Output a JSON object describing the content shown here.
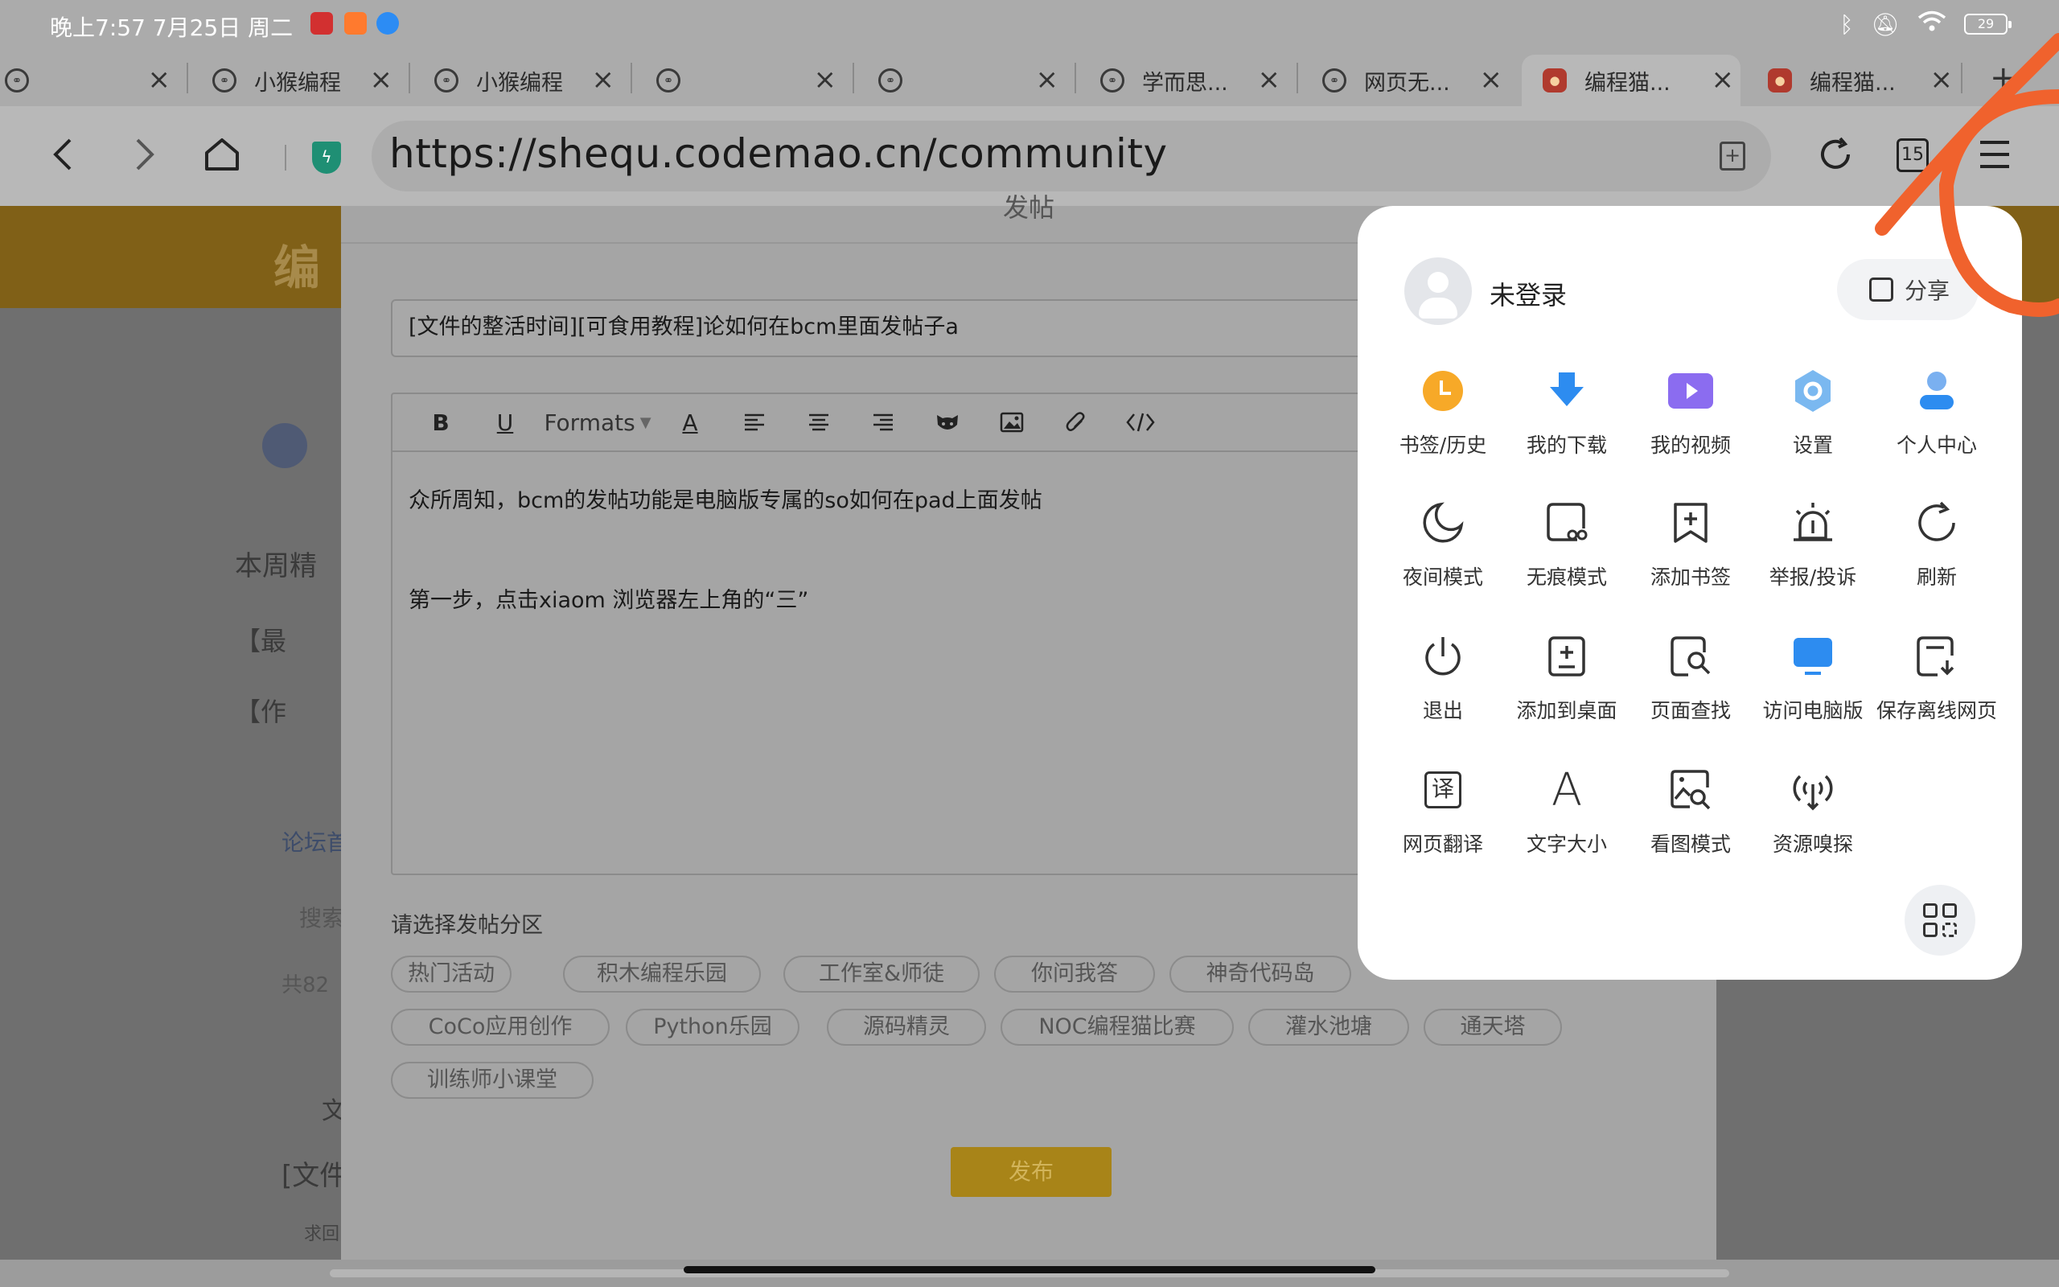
{
  "status_bar": {
    "time": "晚上7:57 7月25日 周二",
    "battery": "29"
  },
  "tabs": [
    {
      "title": ""
    },
    {
      "title": "小猴编程"
    },
    {
      "title": "小猴编程"
    },
    {
      "title": ""
    },
    {
      "title": ""
    },
    {
      "title": "学而思..."
    },
    {
      "title": "网页无..."
    },
    {
      "title": "编程猫..."
    },
    {
      "title": "编程猫..."
    }
  ],
  "toolbar": {
    "url": "https://shequ.codemao.cn/community",
    "tab_count": "15"
  },
  "page": {
    "banner_logo": "编",
    "sidebar": [
      "本周精",
      "【最",
      "【作",
      "论坛首",
      "搜索",
      "共82",
      "文",
      "[文件",
      "求回"
    ]
  },
  "post_editor": {
    "header": "发帖",
    "title_value": "[文件的整活时间][可食用教程]论如何在bcm里面发帖子a",
    "toolbar_items": [
      "B",
      "U",
      "Formats",
      "A"
    ],
    "body_lines": [
      "众所周知，bcm的发帖功能是电脑版专属的so如何在pad上面发帖",
      "",
      "第一步，点击xiaom 浏览器左上角的“三”"
    ],
    "section_label": "请选择发帖分区",
    "sections": [
      "热门活动",
      "积木编程乐园",
      "工作室&师徒",
      "你问我答",
      "神奇代码岛",
      "CoCo应用创作",
      "Python乐园",
      "源码精灵",
      "NOC编程猫比赛",
      "灌水池塘",
      "通天塔",
      "训练师小课堂"
    ],
    "publish_label": "发布"
  },
  "menu": {
    "login_label": "未登录",
    "share_label": "分享",
    "items": [
      {
        "label": "书签/历史",
        "icon": "bookmark-history-icon"
      },
      {
        "label": "我的下载",
        "icon": "download-icon"
      },
      {
        "label": "我的视频",
        "icon": "video-icon"
      },
      {
        "label": "设置",
        "icon": "settings-icon"
      },
      {
        "label": "个人中心",
        "icon": "profile-icon"
      },
      {
        "label": "夜间模式",
        "icon": "night-mode-icon"
      },
      {
        "label": "无痕模式",
        "icon": "incognito-icon"
      },
      {
        "label": "添加书签",
        "icon": "add-bookmark-icon"
      },
      {
        "label": "举报/投诉",
        "icon": "report-icon"
      },
      {
        "label": "刷新",
        "icon": "refresh-icon"
      },
      {
        "label": "退出",
        "icon": "power-icon"
      },
      {
        "label": "添加到桌面",
        "icon": "add-to-desktop-icon"
      },
      {
        "label": "页面查找",
        "icon": "find-in-page-icon"
      },
      {
        "label": "访问电脑版",
        "icon": "desktop-version-icon"
      },
      {
        "label": "保存离线网页",
        "icon": "save-offline-icon"
      },
      {
        "label": "网页翻译",
        "icon": "translate-icon"
      },
      {
        "label": "文字大小",
        "icon": "text-size-icon"
      },
      {
        "label": "看图模式",
        "icon": "image-mode-icon"
      },
      {
        "label": "资源嗅探",
        "icon": "resource-sniff-icon"
      }
    ],
    "translate_glyph": "译",
    "text_size_glyph": "A"
  },
  "colors": {
    "accent_blue": "#2d8cf0",
    "accent_orange": "#f7a928",
    "accent_purple": "#8b6cf0",
    "scribble": "#f0622d"
  }
}
